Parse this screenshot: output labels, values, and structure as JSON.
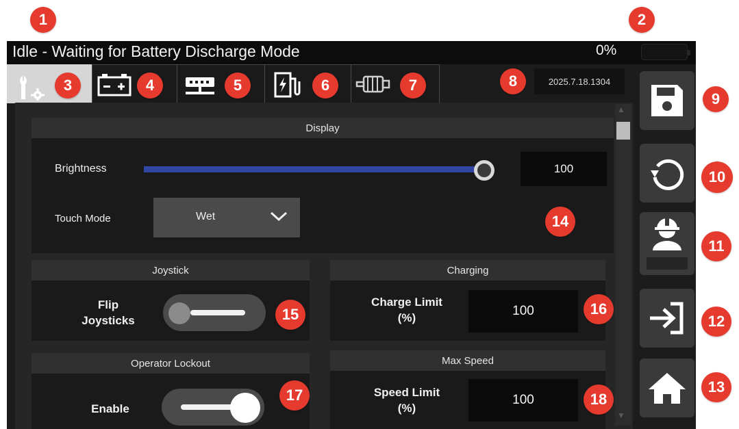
{
  "status": {
    "text": "Idle - Waiting for Battery Discharge Mode",
    "percent": "0%"
  },
  "tabs": [
    {
      "icon": "wrench-gear-icon",
      "active": true
    },
    {
      "icon": "battery-icon"
    },
    {
      "icon": "network-icon"
    },
    {
      "icon": "charging-station-icon"
    },
    {
      "icon": "motor-icon"
    }
  ],
  "version": "2025.7.18.1304",
  "sidebar": [
    {
      "icon": "save-icon"
    },
    {
      "icon": "reset-icon"
    },
    {
      "icon": "operator-icon"
    },
    {
      "icon": "login-icon"
    },
    {
      "icon": "home-icon"
    }
  ],
  "display": {
    "title": "Display",
    "brightness_label": "Brightness",
    "brightness_value": "100",
    "brightness_level": 1.0,
    "touch_mode_label": "Touch Mode",
    "touch_mode_value": "Wet"
  },
  "joystick": {
    "title": "Joystick",
    "flip_label_line1": "Flip",
    "flip_label_line2": "Joysticks",
    "flip_enabled": false
  },
  "charging": {
    "title": "Charging",
    "limit_label_line1": "Charge Limit",
    "limit_label_line2": "(%)",
    "limit_value": "100"
  },
  "operator_lockout": {
    "title": "Operator Lockout",
    "enable_label": "Enable",
    "enabled": true
  },
  "max_speed": {
    "title": "Max Speed",
    "limit_label_line1": "Speed Limit",
    "limit_label_line2": "(%)",
    "limit_value": "100"
  },
  "callouts": [
    "1",
    "2",
    "3",
    "4",
    "5",
    "6",
    "7",
    "8",
    "9",
    "10",
    "11",
    "12",
    "13",
    "14",
    "15",
    "16",
    "17",
    "18"
  ],
  "colors": {
    "callout": "#e63a2e",
    "slider": "#3145a3",
    "background": "#1c1c1c"
  }
}
